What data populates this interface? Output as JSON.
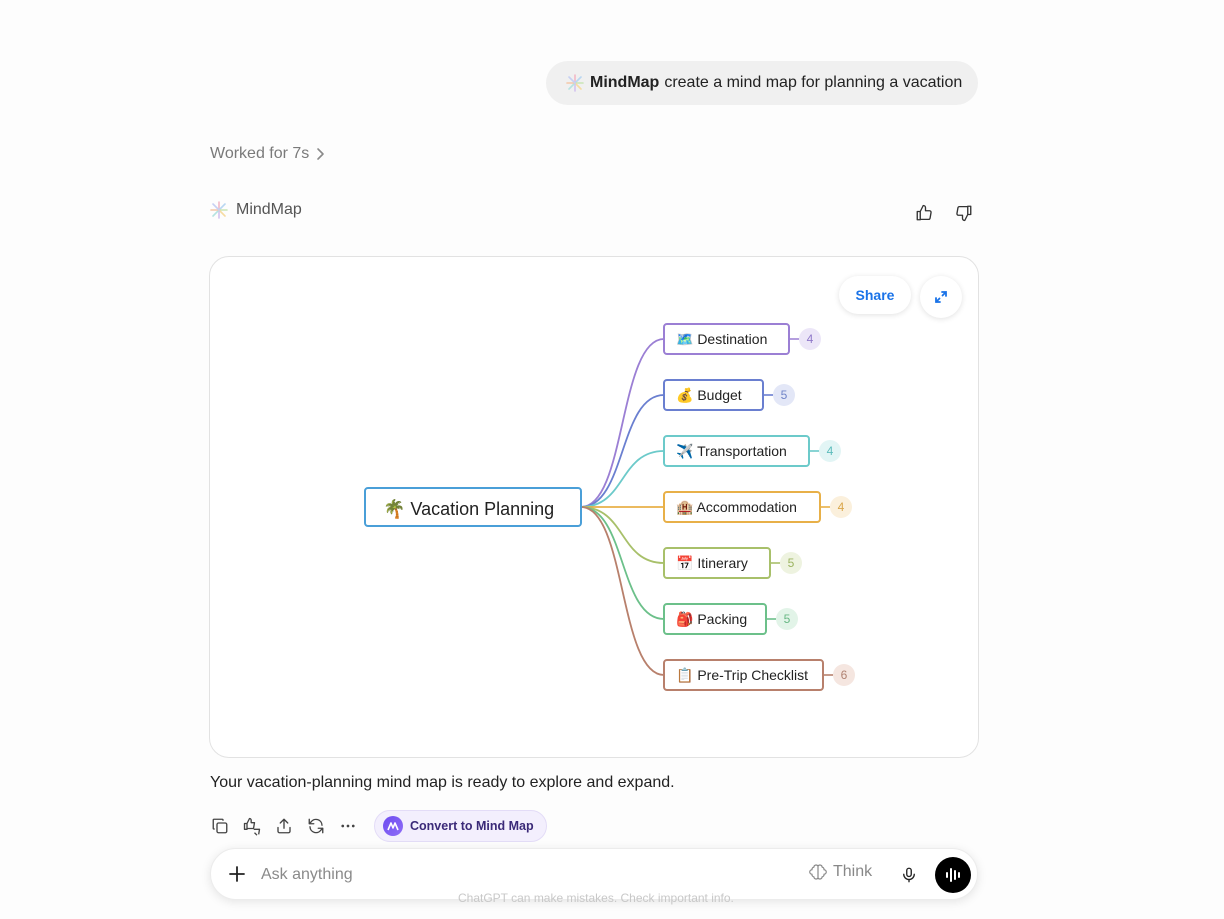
{
  "user_message": {
    "app_name": "MindMap",
    "text": "create a mind map for planning a vacation"
  },
  "worked_for": "Worked for 7s",
  "assistant": {
    "app_name": "MindMap"
  },
  "card": {
    "share_label": "Share"
  },
  "mindmap": {
    "root": {
      "label": "🌴 Vacation Planning",
      "color": "#4a9fd8"
    },
    "branches": [
      {
        "label": "🗺️ Destination",
        "count": "4",
        "color": "#9b7fd4",
        "badge_bg": "#ece6f8",
        "badge_fg": "#8f78c9"
      },
      {
        "label": "💰 Budget",
        "count": "5",
        "color": "#6a7fd0",
        "badge_bg": "#e3e7f7",
        "badge_fg": "#7084c8"
      },
      {
        "label": "✈️ Transportation",
        "count": "4",
        "color": "#6ccaca",
        "badge_bg": "#e2f5f5",
        "badge_fg": "#5cbcbc"
      },
      {
        "label": "🏨 Accommodation",
        "count": "4",
        "color": "#e8b048",
        "badge_bg": "#fbf0dc",
        "badge_fg": "#d9a64a"
      },
      {
        "label": "📅 Itinerary",
        "count": "5",
        "color": "#a8c06a",
        "badge_bg": "#eef3e0",
        "badge_fg": "#9cb460"
      },
      {
        "label": "🎒 Packing",
        "count": "5",
        "color": "#6cc08a",
        "badge_bg": "#e2f4e8",
        "badge_fg": "#68b884"
      },
      {
        "label": "📋 Pre-Trip Checklist",
        "count": "6",
        "color": "#b8806c",
        "badge_bg": "#f5e6e0",
        "badge_fg": "#b08272"
      }
    ]
  },
  "summary": "Your vacation-planning mind map is ready to explore and expand.",
  "actions": {
    "convert_label": "Convert to Mind Map"
  },
  "composer": {
    "placeholder": "Ask anything",
    "think_label": "Think"
  },
  "disclaimer": "ChatGPT can make mistakes. Check important info."
}
